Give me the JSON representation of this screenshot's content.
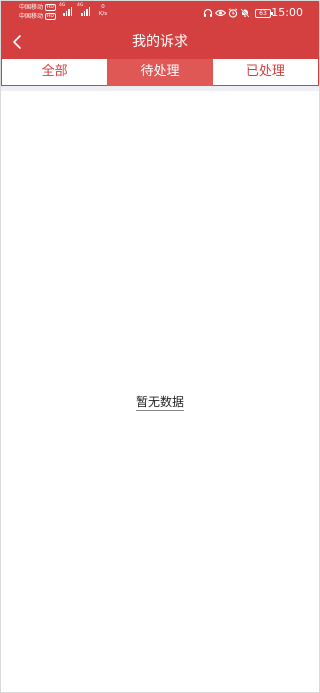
{
  "status_bar": {
    "carrier_1": "中国移动",
    "carrier_2": "中国移动",
    "hd_badge": "HD",
    "network_type": "4G",
    "net_speed_value": "0",
    "net_speed_unit": "K/s",
    "battery_level": "63",
    "time": "15:00",
    "icons": [
      "headphones-icon",
      "eye-icon",
      "alarm-icon",
      "mute-icon",
      "battery-icon"
    ]
  },
  "header": {
    "title": "我的诉求",
    "back_icon": "chevron-left-icon"
  },
  "tabs": [
    {
      "label": "全部",
      "active": false
    },
    {
      "label": "待处理",
      "active": true
    },
    {
      "label": "已处理",
      "active": false
    }
  ],
  "content": {
    "empty_text": "暂无数据"
  },
  "colors": {
    "brand": "#d4403f",
    "active_tab": "#df5856",
    "background": "#ffffff"
  }
}
